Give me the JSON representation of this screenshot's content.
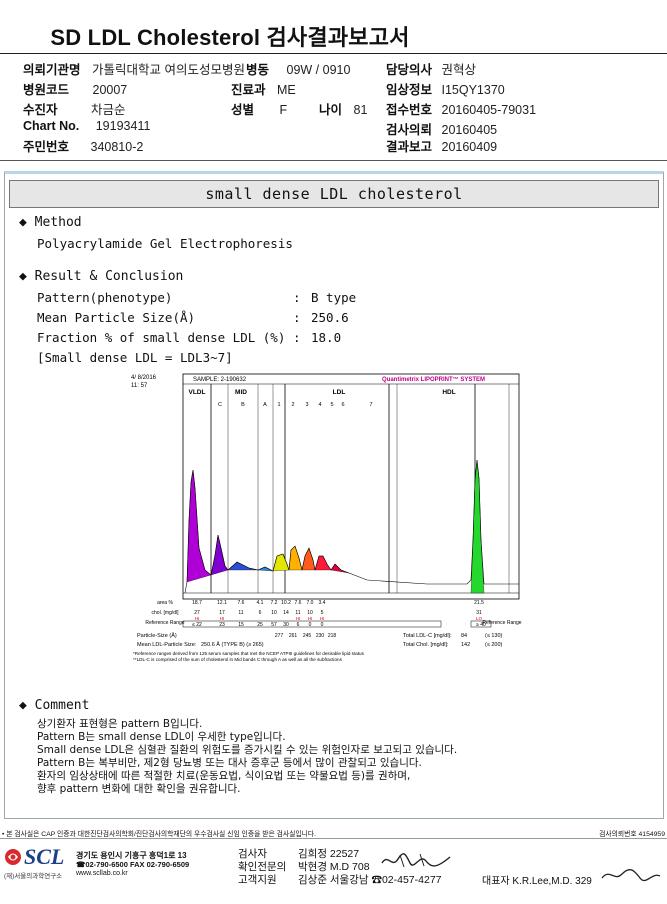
{
  "title": "SD LDL Cholesterol 검사결과보고서",
  "header": {
    "institution_label": "의뢰기관명",
    "institution_value": "가톨릭대학교 여의도성모병원",
    "ward_label": "병동",
    "ward_value": "09W / 0910",
    "doctor_label": "담당의사",
    "doctor_value": "권혁상",
    "hospital_code_label": "병원코드",
    "hospital_code_value": "20007",
    "dept_label": "진료과",
    "dept_value": "ME",
    "clinical_label": "임상정보",
    "clinical_value": "I15QY1370",
    "patient_label": "수진자",
    "patient_value": "차금순",
    "sex_label": "성별",
    "sex_value": "F",
    "age_label": "나이",
    "age_value": "81",
    "receipt_label": "접수번호",
    "receipt_value": "20160405-79031",
    "chart_label": "Chart No.",
    "chart_value": "19193411",
    "request_label": "검사의뢰",
    "request_value": "20160405",
    "id_label": "주민번호",
    "id_value": "340810-2",
    "report_label": "결과보고",
    "report_value": "20160409"
  },
  "report": {
    "banner": "small dense LDL cholesterol",
    "method_heading": "◆ Method",
    "method_value": "Polyacrylamide Gel Electrophoresis",
    "result_heading": "◆ Result & Conclusion",
    "pattern_label": "Pattern(phenotype)",
    "pattern_value": "B type",
    "size_label": "Mean Particle Size(Å)",
    "size_value": "250.6",
    "fraction_label": "Fraction % of small dense LDL (%)",
    "fraction_value": "18.0",
    "definition": "[Small dense LDL = LDL3~7]",
    "sep": ":",
    "comment_heading": "◆ Comment",
    "comments": [
      "상기환자 표현형은 pattern B입니다.",
      "Pattern B는 small dense LDL이 우세한 type입니다.",
      "Small dense LDL은 심혈관 질환의 위험도를 증가시킬 수 있는 위험인자로 보고되고 있습니다.",
      "Pattern B는 복부비만, 제2형 당뇨병 또는 대사 증후군 등에서 많이 관찰되고 있습니다.",
      "환자의 임상상태에 따른 적절한 치료(운동요법, 식이요법 또는 약물요법 등)를 권하며,",
      "향후 pattern 변화에 대한 확인을 권유합니다."
    ]
  },
  "graph": {
    "date": "4/ 8/2016",
    "time": "11: 57",
    "sample": "SAMPLE: 2-190632",
    "brand": "Quantimetrix LIPOPRINT™ SYSTEM",
    "vldl": "VLDL",
    "mid": "MID",
    "ldl": "LDL",
    "hdl": "HDL",
    "mid_bands": [
      "C",
      "B",
      "A"
    ],
    "ldl_bands": [
      "1",
      "2",
      "3",
      "4",
      "5",
      "6",
      "7"
    ],
    "area_label": "area %",
    "area_values": [
      "18.7",
      "12.1",
      "7.6",
      "4.1",
      "7.2",
      "10.2",
      "7.6",
      "7.0",
      "3.4",
      "21.5"
    ],
    "chol_label": "chol. [mg/dl]",
    "chol_values": [
      "27",
      "17",
      "11",
      "6",
      "10",
      "14",
      "11",
      "10",
      "5",
      "31"
    ],
    "hi_flags": [
      "HI",
      "HI",
      "HI",
      "HI",
      "HI"
    ],
    "lo_flag": "LO",
    "ref_label": "Reference Range",
    "ref_values": [
      "≤ 22",
      "23",
      "15",
      "25",
      "57",
      "30",
      "6",
      "0",
      "0",
      "≥ 40"
    ],
    "ref_label_right": "Reference Range",
    "particle_label": "Particle-Size (Å)",
    "particle_values": [
      "277",
      "261",
      "245",
      "230",
      "218"
    ],
    "total_ldl_label": "Total LDL-C [mg/dl]:",
    "total_ldl_value": "84",
    "total_ldl_ref": "(≤ 130)",
    "mean_label": "Mean LDL-Particle Size:",
    "mean_value": "250.6 Å (TYPE B) (≥ 265)",
    "total_chol_label": "Total Chol. [mg/dl]:",
    "total_chol_value": "142",
    "total_chol_ref": "(≤ 200)",
    "footnote1": "*Reference ranges derived from 125 serum samples that met the NCEP ATPIII guidelines for desirable lipid status",
    "footnote2": "**LDL-C is comprised of the sum of cholesterol in Mid bands C through A as well as all the subfractions"
  },
  "footer": {
    "note": "• 본 검사실은 CAP 인증과 대한진단검사의학회/진단검사의학재단의 우수검사실 신임 인증을 받은 검사실입니다.",
    "note_right": "검사의뢰번호 4154959",
    "logo_text": "SCL",
    "logo_sub": "(재)서울의과학연구소",
    "address": "경기도 용인시 기흥구 흥덕1로 13",
    "phone": "☎02-790-6500  FAX 02-790-6509",
    "web": "www.scllab.co.kr",
    "tester_label": "검사자",
    "tester_value": "김희정 22527",
    "confirmer_label": "확인전문의",
    "confirmer_value": "박현경 M.D 708",
    "support_label": "고객지원",
    "support_value": "김상준 서울강남 ☎02-457-4277",
    "ceo": "대표자 K.R.Lee,M.D. 329"
  }
}
